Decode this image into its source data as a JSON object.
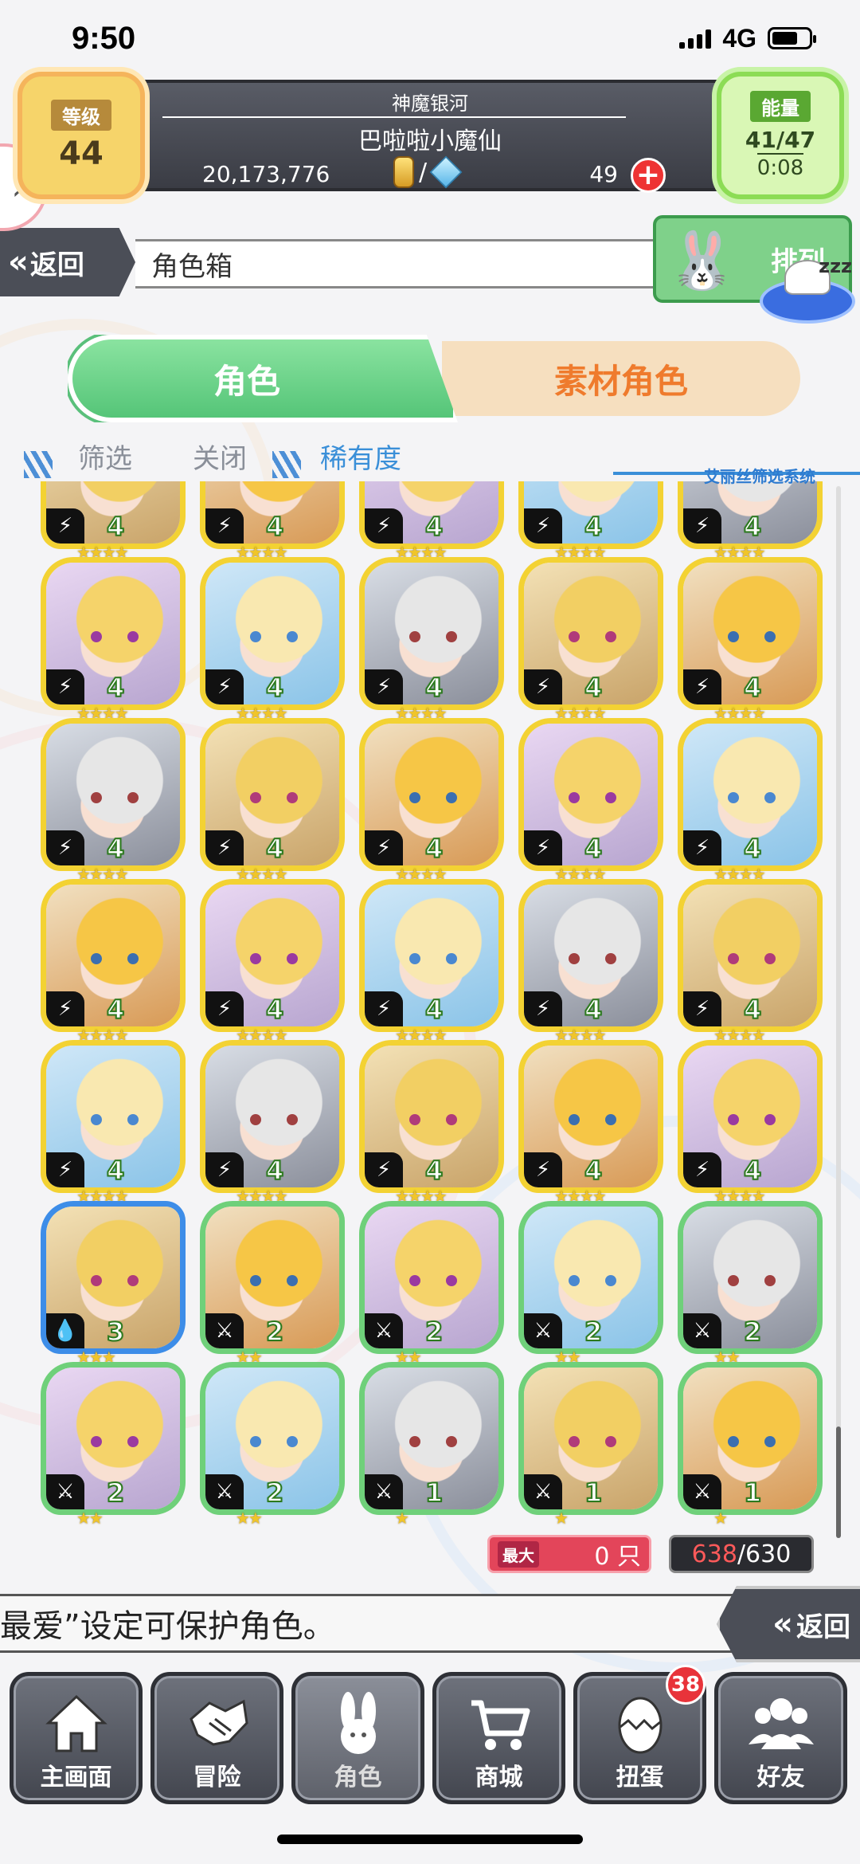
{
  "status_bar": {
    "time": "9:50",
    "network": "4G"
  },
  "header": {
    "level_label": "等级",
    "level_value": "44",
    "region": "神魔银河",
    "player_name": "巴啦啦小魔仙",
    "coins": "20,173,776",
    "slash": "/",
    "gems": "49",
    "add_symbol": "+",
    "energy_label": "能量",
    "energy_value": "41/47",
    "energy_timer": "0:08",
    "expand_symbol": "›"
  },
  "nav_top": {
    "back_label": "返回",
    "back_chevron": "«",
    "page_title": "角色箱",
    "sort_label": "排列",
    "zzz": "zzz"
  },
  "tabs": {
    "characters": "角色",
    "materials": "素材角色"
  },
  "filters": {
    "filter": "筛选",
    "close": "关闭",
    "rarity": "稀有度",
    "system": "艾丽丝筛选系统"
  },
  "characters": [
    {
      "level": "4",
      "stars": "★★★★",
      "frame": "#f3d233",
      "elem": "⚡"
    },
    {
      "level": "4",
      "stars": "★★★★",
      "frame": "#f3d233",
      "elem": "⚡"
    },
    {
      "level": "4",
      "stars": "★★★★",
      "frame": "#f3d233",
      "elem": "⚡"
    },
    {
      "level": "4",
      "stars": "★★★★",
      "frame": "#f3d233",
      "elem": "⚡"
    },
    {
      "level": "4",
      "stars": "★★★★",
      "frame": "#f3d233",
      "elem": "⚡"
    },
    {
      "level": "4",
      "stars": "★★★★",
      "frame": "#f3d233",
      "elem": "⚡"
    },
    {
      "level": "4",
      "stars": "★★★★",
      "frame": "#f3d233",
      "elem": "⚡"
    },
    {
      "level": "4",
      "stars": "★★★★",
      "frame": "#f3d233",
      "elem": "⚡"
    },
    {
      "level": "4",
      "stars": "★★★★",
      "frame": "#f3d233",
      "elem": "⚡"
    },
    {
      "level": "4",
      "stars": "★★★★",
      "frame": "#f3d233",
      "elem": "⚡"
    },
    {
      "level": "4",
      "stars": "★★★★",
      "frame": "#f3d233",
      "elem": "⚡"
    },
    {
      "level": "4",
      "stars": "★★★★",
      "frame": "#f3d233",
      "elem": "⚡"
    },
    {
      "level": "4",
      "stars": "★★★★",
      "frame": "#f3d233",
      "elem": "⚡"
    },
    {
      "level": "4",
      "stars": "★★★★",
      "frame": "#f3d233",
      "elem": "⚡"
    },
    {
      "level": "4",
      "stars": "★★★★",
      "frame": "#f3d233",
      "elem": "⚡"
    },
    {
      "level": "4",
      "stars": "★★★★",
      "frame": "#f3d233",
      "elem": "⚡"
    },
    {
      "level": "4",
      "stars": "★★★★",
      "frame": "#f3d233",
      "elem": "⚡"
    },
    {
      "level": "4",
      "stars": "★★★★",
      "frame": "#f3d233",
      "elem": "⚡"
    },
    {
      "level": "4",
      "stars": "★★★★",
      "frame": "#f3d233",
      "elem": "⚡"
    },
    {
      "level": "4",
      "stars": "★★★★",
      "frame": "#f3d233",
      "elem": "⚡"
    },
    {
      "level": "4",
      "stars": "★★★★",
      "frame": "#f3d233",
      "elem": "⚡"
    },
    {
      "level": "4",
      "stars": "★★★★",
      "frame": "#f3d233",
      "elem": "⚡"
    },
    {
      "level": "4",
      "stars": "★★★★",
      "frame": "#f3d233",
      "elem": "⚡"
    },
    {
      "level": "4",
      "stars": "★★★★",
      "frame": "#f3d233",
      "elem": "⚡"
    },
    {
      "level": "4",
      "stars": "★★★★",
      "frame": "#f3d233",
      "elem": "⚡"
    },
    {
      "level": "3",
      "stars": "★★★",
      "frame": "#3d8de8",
      "elem": "💧"
    },
    {
      "level": "2",
      "stars": "★★",
      "frame": "#6fd07a",
      "elem": "⚔"
    },
    {
      "level": "2",
      "stars": "★★",
      "frame": "#6fd07a",
      "elem": "⚔"
    },
    {
      "level": "2",
      "stars": "★★",
      "frame": "#6fd07a",
      "elem": "⚔"
    },
    {
      "level": "2",
      "stars": "★★",
      "frame": "#6fd07a",
      "elem": "⚔"
    },
    {
      "level": "2",
      "stars": "★★",
      "frame": "#6fd07a",
      "elem": "⚔"
    },
    {
      "level": "2",
      "stars": "★★",
      "frame": "#6fd07a",
      "elem": "⚔"
    },
    {
      "level": "1",
      "stars": "★",
      "frame": "#6fd07a",
      "elem": "⚔"
    },
    {
      "level": "1",
      "stars": "★",
      "frame": "#6fd07a",
      "elem": "⚔"
    },
    {
      "level": "1",
      "stars": "★",
      "frame": "#6fd07a",
      "elem": "⚔"
    }
  ],
  "counters": {
    "max_label": "最大",
    "max_value": "0 只",
    "current": "638",
    "separator": "/",
    "capacity": "630"
  },
  "tip": {
    "text": "最爱”设定可保护角色。",
    "back_label": "返回",
    "back_chevron": "«"
  },
  "bottom_nav": [
    {
      "label": "主画面",
      "icon": "home-icon"
    },
    {
      "label": "冒险",
      "icon": "handshake-icon"
    },
    {
      "label": "角色",
      "icon": "rabbit-icon"
    },
    {
      "label": "商城",
      "icon": "cart-icon"
    },
    {
      "label": "扭蛋",
      "icon": "egg-icon",
      "badge": "38"
    },
    {
      "label": "好友",
      "icon": "friends-icon"
    }
  ]
}
